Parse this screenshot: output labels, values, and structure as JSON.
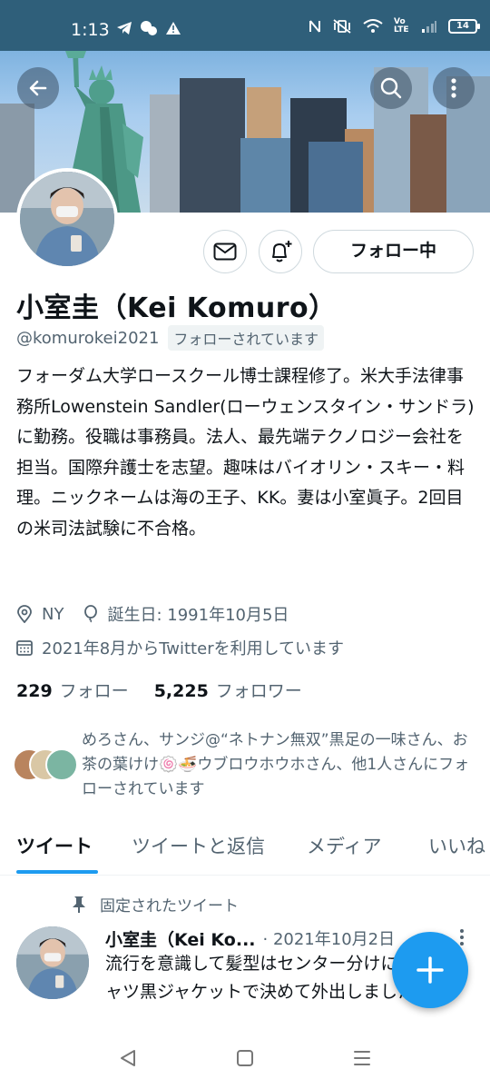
{
  "status_bar": {
    "time": "1:13",
    "network": "Vo LTE",
    "battery": "14"
  },
  "header": {
    "back_icon": "arrow-left-icon",
    "search_icon": "search-icon",
    "more_icon": "more-vertical-icon"
  },
  "profile": {
    "display_name": "小室圭（Kei Komuro）",
    "handle": "@komurokei2021",
    "follows_you_label": "フォローされています",
    "follow_button_label": "フォロー中",
    "bio": "フォーダム大学ロースクール博士課程修了。米大手法律事務所Lowenstein Sandler(ローウェンスタイン・サンドラ)に勤務。役職は事務員。法人、最先端テクノロジー会社を担当。国際弁護士を志望。趣味はバイオリン・スキー・料理。ニックネームは海の王子、KK。妻は小室眞子。2回目の米司法試験に不合格。",
    "location": "NY",
    "birthday": "誕生日: 1991年10月5日",
    "joined": "2021年8月からTwitterを利用しています",
    "following_count": "229",
    "following_label": "フォロー",
    "followers_count": "5,225",
    "followers_label": "フォロワー",
    "followed_by_text": "めろさん、サンジ@“ネトナン無双”黒足の一味さん、お茶の葉けけ🍥🍜ウブロウホウホさん、他1人さんにフォローされています"
  },
  "tabs": [
    {
      "label": "ツイート",
      "active": true
    },
    {
      "label": "ツイートと返信",
      "active": false
    },
    {
      "label": "メディア",
      "active": false
    },
    {
      "label": "いいね",
      "active": false
    }
  ],
  "pinned_tweet": {
    "pinned_label": "固定されたツイート",
    "author_name": "小室圭（Kei Ko...",
    "date": "· 2021年10月2日",
    "text": "流行を意識して髪型はセンター分けにして黒シャツ黒ジャケットで決めて外出しました。"
  },
  "fab": {
    "icon": "plus-icon"
  },
  "nav": {
    "back_icon": "triangle-back-icon",
    "home_icon": "square-home-icon",
    "recents_icon": "menu-lines-icon"
  },
  "colors": {
    "accent": "#1d9bf0",
    "status_bar": "#2f5f7a",
    "secondary_text": "#536471"
  }
}
